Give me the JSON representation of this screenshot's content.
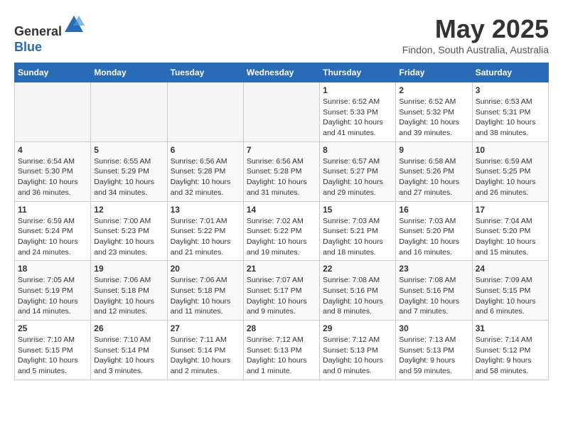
{
  "header": {
    "logo_line1": "General",
    "logo_line2": "Blue",
    "month_title": "May 2025",
    "location": "Findon, South Australia, Australia"
  },
  "weekdays": [
    "Sunday",
    "Monday",
    "Tuesday",
    "Wednesday",
    "Thursday",
    "Friday",
    "Saturday"
  ],
  "weeks": [
    [
      {
        "day": "",
        "empty": true
      },
      {
        "day": "",
        "empty": true
      },
      {
        "day": "",
        "empty": true
      },
      {
        "day": "",
        "empty": true
      },
      {
        "day": "1",
        "sunrise": "6:52 AM",
        "sunset": "5:33 PM",
        "daylight": "10 hours and 41 minutes."
      },
      {
        "day": "2",
        "sunrise": "6:52 AM",
        "sunset": "5:32 PM",
        "daylight": "10 hours and 39 minutes."
      },
      {
        "day": "3",
        "sunrise": "6:53 AM",
        "sunset": "5:31 PM",
        "daylight": "10 hours and 38 minutes."
      }
    ],
    [
      {
        "day": "4",
        "sunrise": "6:54 AM",
        "sunset": "5:30 PM",
        "daylight": "10 hours and 36 minutes."
      },
      {
        "day": "5",
        "sunrise": "6:55 AM",
        "sunset": "5:29 PM",
        "daylight": "10 hours and 34 minutes."
      },
      {
        "day": "6",
        "sunrise": "6:56 AM",
        "sunset": "5:28 PM",
        "daylight": "10 hours and 32 minutes."
      },
      {
        "day": "7",
        "sunrise": "6:56 AM",
        "sunset": "5:28 PM",
        "daylight": "10 hours and 31 minutes."
      },
      {
        "day": "8",
        "sunrise": "6:57 AM",
        "sunset": "5:27 PM",
        "daylight": "10 hours and 29 minutes."
      },
      {
        "day": "9",
        "sunrise": "6:58 AM",
        "sunset": "5:26 PM",
        "daylight": "10 hours and 27 minutes."
      },
      {
        "day": "10",
        "sunrise": "6:59 AM",
        "sunset": "5:25 PM",
        "daylight": "10 hours and 26 minutes."
      }
    ],
    [
      {
        "day": "11",
        "sunrise": "6:59 AM",
        "sunset": "5:24 PM",
        "daylight": "10 hours and 24 minutes."
      },
      {
        "day": "12",
        "sunrise": "7:00 AM",
        "sunset": "5:23 PM",
        "daylight": "10 hours and 23 minutes."
      },
      {
        "day": "13",
        "sunrise": "7:01 AM",
        "sunset": "5:22 PM",
        "daylight": "10 hours and 21 minutes."
      },
      {
        "day": "14",
        "sunrise": "7:02 AM",
        "sunset": "5:22 PM",
        "daylight": "10 hours and 19 minutes."
      },
      {
        "day": "15",
        "sunrise": "7:03 AM",
        "sunset": "5:21 PM",
        "daylight": "10 hours and 18 minutes."
      },
      {
        "day": "16",
        "sunrise": "7:03 AM",
        "sunset": "5:20 PM",
        "daylight": "10 hours and 16 minutes."
      },
      {
        "day": "17",
        "sunrise": "7:04 AM",
        "sunset": "5:20 PM",
        "daylight": "10 hours and 15 minutes."
      }
    ],
    [
      {
        "day": "18",
        "sunrise": "7:05 AM",
        "sunset": "5:19 PM",
        "daylight": "10 hours and 14 minutes."
      },
      {
        "day": "19",
        "sunrise": "7:06 AM",
        "sunset": "5:18 PM",
        "daylight": "10 hours and 12 minutes."
      },
      {
        "day": "20",
        "sunrise": "7:06 AM",
        "sunset": "5:18 PM",
        "daylight": "10 hours and 11 minutes."
      },
      {
        "day": "21",
        "sunrise": "7:07 AM",
        "sunset": "5:17 PM",
        "daylight": "10 hours and 9 minutes."
      },
      {
        "day": "22",
        "sunrise": "7:08 AM",
        "sunset": "5:16 PM",
        "daylight": "10 hours and 8 minutes."
      },
      {
        "day": "23",
        "sunrise": "7:08 AM",
        "sunset": "5:16 PM",
        "daylight": "10 hours and 7 minutes."
      },
      {
        "day": "24",
        "sunrise": "7:09 AM",
        "sunset": "5:15 PM",
        "daylight": "10 hours and 6 minutes."
      }
    ],
    [
      {
        "day": "25",
        "sunrise": "7:10 AM",
        "sunset": "5:15 PM",
        "daylight": "10 hours and 5 minutes."
      },
      {
        "day": "26",
        "sunrise": "7:10 AM",
        "sunset": "5:14 PM",
        "daylight": "10 hours and 3 minutes."
      },
      {
        "day": "27",
        "sunrise": "7:11 AM",
        "sunset": "5:14 PM",
        "daylight": "10 hours and 2 minutes."
      },
      {
        "day": "28",
        "sunrise": "7:12 AM",
        "sunset": "5:13 PM",
        "daylight": "10 hours and 1 minute."
      },
      {
        "day": "29",
        "sunrise": "7:12 AM",
        "sunset": "5:13 PM",
        "daylight": "10 hours and 0 minutes."
      },
      {
        "day": "30",
        "sunrise": "7:13 AM",
        "sunset": "5:13 PM",
        "daylight": "9 hours and 59 minutes."
      },
      {
        "day": "31",
        "sunrise": "7:14 AM",
        "sunset": "5:12 PM",
        "daylight": "9 hours and 58 minutes."
      }
    ]
  ]
}
